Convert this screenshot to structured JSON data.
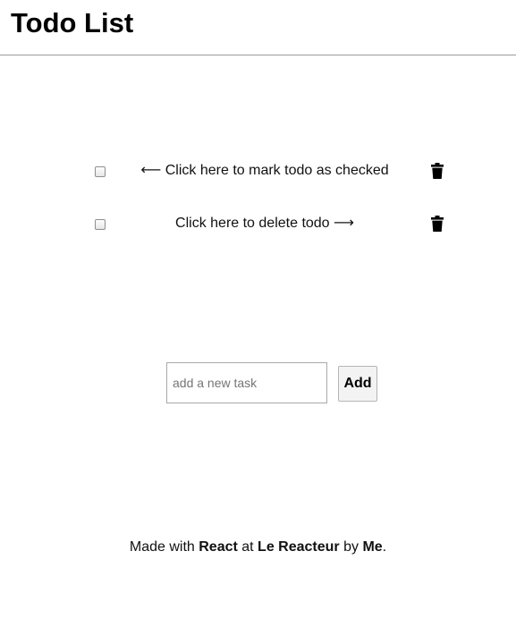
{
  "header": {
    "title": "Todo List"
  },
  "todos": [
    {
      "checked": false,
      "prefix_arrow": "⟵",
      "text": "Click here to mark todo as checked",
      "suffix_arrow": ""
    },
    {
      "checked": false,
      "prefix_arrow": "",
      "text": "Click here to delete todo",
      "suffix_arrow": "⟶"
    }
  ],
  "icons": {
    "delete": "trash-icon"
  },
  "form": {
    "input_value": "",
    "input_placeholder": "add a new task",
    "add_label": "Add"
  },
  "footer": {
    "part1": "Made with ",
    "react": "React",
    "part2": " at ",
    "company": "Le Reacteur",
    "part3": " by ",
    "author": "Me",
    "part4": "."
  }
}
